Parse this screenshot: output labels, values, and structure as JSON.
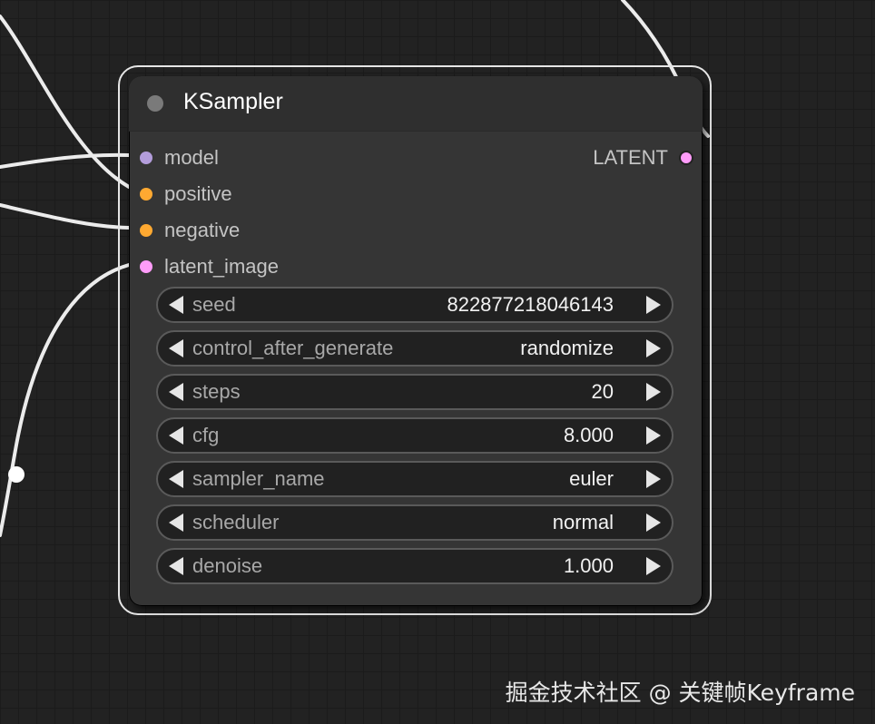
{
  "node": {
    "title": "KSampler",
    "inputs": [
      {
        "label": "model",
        "color": "#b39ddb"
      },
      {
        "label": "positive",
        "color": "#ffa931"
      },
      {
        "label": "negative",
        "color": "#ffa931"
      },
      {
        "label": "latent_image",
        "color": "#ff9cf9"
      }
    ],
    "output": {
      "label": "LATENT",
      "color": "#ff9cf9"
    },
    "widgets": [
      {
        "name": "seed",
        "value": "822877218046143"
      },
      {
        "name": "control_after_generate",
        "value": "randomize"
      },
      {
        "name": "steps",
        "value": "20"
      },
      {
        "name": "cfg",
        "value": "8.000"
      },
      {
        "name": "sampler_name",
        "value": "euler"
      },
      {
        "name": "scheduler",
        "value": "normal"
      },
      {
        "name": "denoise",
        "value": "1.000"
      }
    ]
  },
  "watermark": "掘金技术社区 @ 关键帧Keyframe"
}
